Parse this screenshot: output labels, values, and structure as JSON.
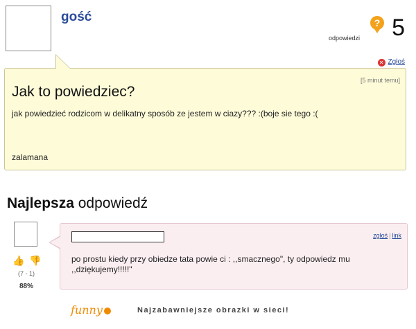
{
  "question": {
    "author": "gość",
    "answers_count": "5",
    "answers_label": "odpowiedzi",
    "report_label": "Zgłoś",
    "time_ago": "[5 minut temu]",
    "title": "Jak to powiedziec?",
    "body": "jak powiedzieć rodzicom w delikatny sposób ze jestem w ciazy??? :(boje sie tego :(",
    "signature": "zalamana"
  },
  "best_answer": {
    "heading_bold": "Najlepsza",
    "heading_rest": "odpowiedź",
    "votes": "(7 - 1)",
    "percent": "88%",
    "report_label": "zgłoś",
    "link_label": "link",
    "body": "po prostu kiedy przy obiedze tata powie ci : ,,smacznego\", ty odpowiedz mu ,,dziękujemy!!!!!\""
  },
  "footer": {
    "logo": "funny",
    "tagline": "Najzabawniejsze obrazki w sieci!"
  },
  "colors": {
    "username": "#2a4c9a",
    "question_bg": "#fdfbd8",
    "answer_bg": "#fbeef1",
    "accent_orange": "#f08a00"
  }
}
